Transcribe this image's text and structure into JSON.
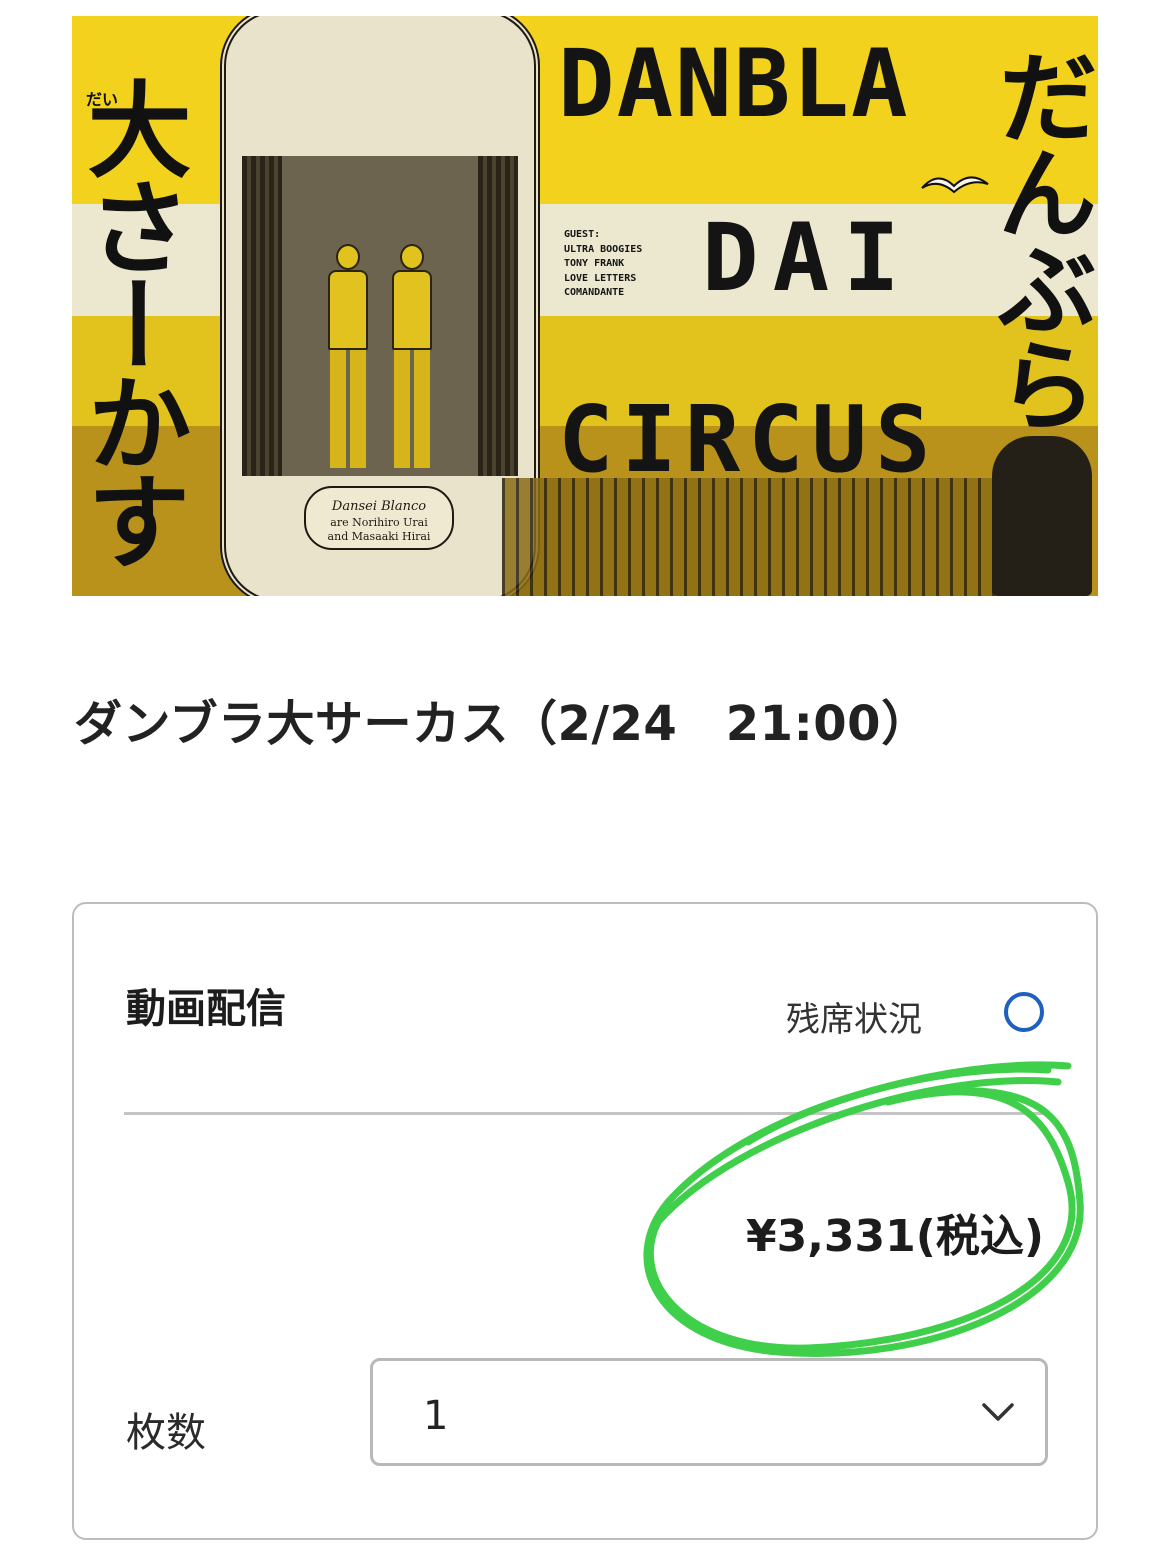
{
  "poster": {
    "vertical_left": "大さーかす",
    "vertical_left_furigana": "だい",
    "vertical_right": "だんぶら",
    "title_line1": "DANBLA",
    "title_line2": "DAI",
    "title_line3": "CIRCUS",
    "guest_label": "GUEST:",
    "guests": [
      "ULTRA BOOGIES",
      "TONY FRANK",
      "LOVE LETTERS",
      "COMANDANTE"
    ],
    "plaque_name": "Dansei Blanco",
    "plaque_line2": "are Norihiro Urai",
    "plaque_line3": "and Masaaki Hirai"
  },
  "event": {
    "title": "ダンブラ大サーカス（2/24　21:00）"
  },
  "ticket_card": {
    "heading": "動画配信",
    "seat_status_label": "残席状況",
    "seat_status_icon": "circle-available-icon",
    "price": "¥3,331(税込)",
    "quantity_label": "枚数",
    "quantity_value": "1",
    "chevron_icon": "chevron-down-icon"
  },
  "colors": {
    "poster_yellow": "#f2d21c",
    "availability_circle": "#1f5fbf",
    "annotation_green": "#3fcf4a",
    "border_gray": "#bdbdbd"
  }
}
